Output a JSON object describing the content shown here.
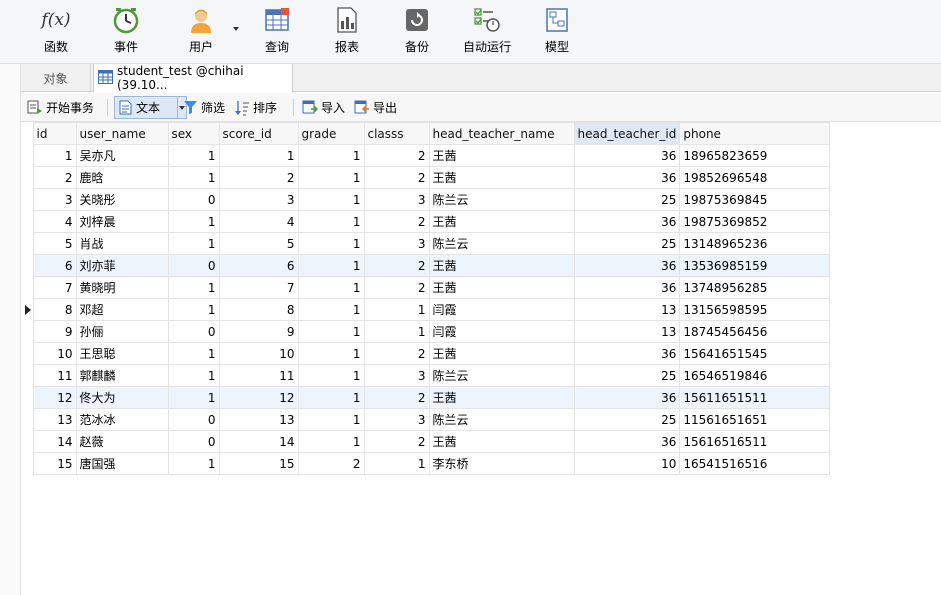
{
  "ribbon": {
    "function_label": "函数",
    "event_label": "事件",
    "user_label": "用户",
    "query_label": "查询",
    "report_label": "报表",
    "backup_label": "备份",
    "automation_label": "自动运行",
    "model_label": "模型",
    "function_icon_text": "f(x)"
  },
  "tabs": {
    "objects_label": "对象",
    "active_label": "student_test @chihai (39.10..."
  },
  "subtoolbar": {
    "begin_transaction_label": "开始事务",
    "text_label": "文本",
    "filter_label": "筛选",
    "sort_label": "排序",
    "import_label": "导入",
    "export_label": "导出"
  },
  "table": {
    "columns": [
      "id",
      "user_name",
      "sex",
      "score_id",
      "grade",
      "classs",
      "head_teacher_name",
      "head_teacher_id",
      "phone"
    ],
    "highlighted_column": "head_teacher_id",
    "current_row_index": 7,
    "rows": [
      [
        "1",
        "吴亦凡",
        "1",
        "1",
        "1",
        "2",
        "王茜",
        "36",
        "18965823659"
      ],
      [
        "2",
        "鹿晗",
        "1",
        "2",
        "1",
        "2",
        "王茜",
        "36",
        "19852696548"
      ],
      [
        "3",
        "关晓彤",
        "0",
        "3",
        "1",
        "3",
        "陈兰云",
        "25",
        "19875369845"
      ],
      [
        "4",
        "刘梓晨",
        "1",
        "4",
        "1",
        "2",
        "王茜",
        "36",
        "19875369852"
      ],
      [
        "5",
        "肖战",
        "1",
        "5",
        "1",
        "3",
        "陈兰云",
        "25",
        "13148965236"
      ],
      [
        "6",
        "刘亦菲",
        "0",
        "6",
        "1",
        "2",
        "王茜",
        "36",
        "13536985159"
      ],
      [
        "7",
        "黄晓明",
        "1",
        "7",
        "1",
        "2",
        "王茜",
        "36",
        "13748956285"
      ],
      [
        "8",
        "邓超",
        "1",
        "8",
        "1",
        "1",
        "闫霞",
        "13",
        "13156598595"
      ],
      [
        "9",
        "孙俪",
        "0",
        "9",
        "1",
        "1",
        "闫霞",
        "13",
        "18745456456"
      ],
      [
        "10",
        "王思聪",
        "1",
        "10",
        "1",
        "2",
        "王茜",
        "36",
        "15641651545"
      ],
      [
        "11",
        "郭麒麟",
        "1",
        "11",
        "1",
        "3",
        "陈兰云",
        "25",
        "16546519846"
      ],
      [
        "12",
        "佟大为",
        "1",
        "12",
        "1",
        "2",
        "王茜",
        "36",
        "15611651511"
      ],
      [
        "13",
        "范冰冰",
        "0",
        "13",
        "1",
        "3",
        "陈兰云",
        "25",
        "11561651651"
      ],
      [
        "14",
        "赵薇",
        "0",
        "14",
        "1",
        "2",
        "王茜",
        "36",
        "15616516511"
      ],
      [
        "15",
        "唐国强",
        "1",
        "15",
        "2",
        "1",
        "李东桥",
        "10",
        "16541516516"
      ]
    ]
  },
  "colors": {
    "selection_row": "#eef4fb",
    "highlighted_header": "#dfe9f6",
    "text_button_active": "#dce8f6"
  }
}
